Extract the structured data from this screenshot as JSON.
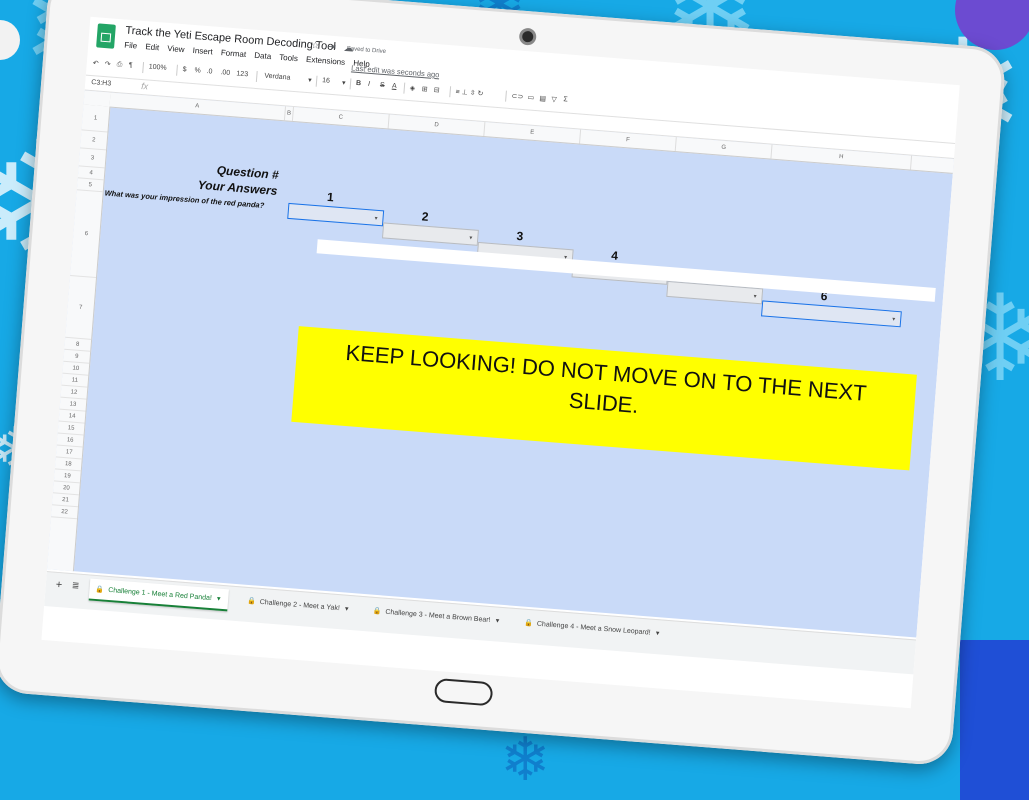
{
  "window": {
    "title": "Track the Yeti Escape Room Decoding Tool",
    "saved_status": "Saved to Drive",
    "last_edit": "Last edit was seconds ago",
    "menu": [
      "File",
      "Edit",
      "View",
      "Insert",
      "Format",
      "Data",
      "Tools",
      "Extensions",
      "Help"
    ]
  },
  "toolbar": {
    "zoom": "100%",
    "currency": "$",
    "percent": "%",
    "decimal_decrease": ".0",
    "decimal_increase": ".00",
    "more_formats": "123",
    "font": "Verdana",
    "font_size": "16",
    "bold": "B",
    "italic": "I",
    "strike": "S",
    "text_color": "A"
  },
  "formula_bar": {
    "name_box": "C3:H3",
    "fx": "fx"
  },
  "columns": [
    "A",
    "B",
    "C",
    "D",
    "E",
    "F",
    "G",
    "H"
  ],
  "rows": [
    "1",
    "2",
    "3",
    "4",
    "5",
    "6",
    "7",
    "8",
    "9",
    "10",
    "11",
    "12",
    "13",
    "14",
    "15",
    "16",
    "17",
    "18",
    "19",
    "20",
    "21",
    "22"
  ],
  "sheet": {
    "question_label": "Question #",
    "answers_label": "Your Answers",
    "prompt": "What was your impression of the red panda?",
    "question_numbers": [
      "1",
      "2",
      "3",
      "4",
      "5",
      "6"
    ],
    "banner": "KEEP LOOKING! DO NOT MOVE ON TO THE NEXT SLIDE."
  },
  "tabs": [
    {
      "label": "Challenge 1 - Meet a Red Panda!",
      "active": true
    },
    {
      "label": "Challenge 2 - Meet a Yak!",
      "active": false
    },
    {
      "label": "Challenge 3 - Meet a Brown Bear!",
      "active": false
    },
    {
      "label": "Challenge 4 - Meet a Snow Leopard!",
      "active": false
    }
  ],
  "icons": [
    "sheets-logo-icon",
    "star-icon",
    "move-icon",
    "cloud-saved-icon",
    "undo-icon",
    "redo-icon",
    "print-icon",
    "paint-format-icon",
    "fill-color-icon",
    "borders-icon",
    "merge-icon",
    "align-icon",
    "link-icon",
    "comment-icon",
    "chart-icon",
    "filter-icon",
    "functions-icon",
    "explore-icon",
    "comments-icon",
    "add-sheet-icon",
    "sheet-list-icon",
    "lock-icon"
  ],
  "colors": {
    "background": "#17a9e6",
    "sheet_fill": "#c9daf8",
    "banner": "#ffff00",
    "active_tab": "#188038",
    "selection": "#1a73e8"
  }
}
